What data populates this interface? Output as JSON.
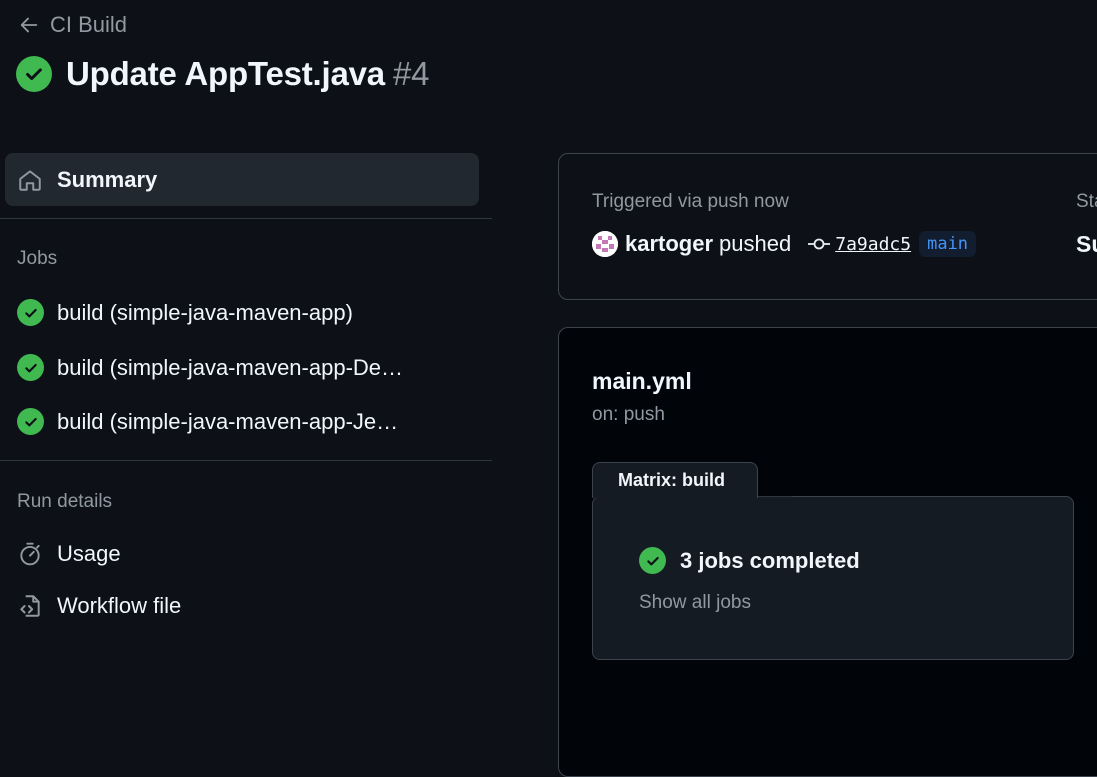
{
  "header": {
    "back_label": "CI Build",
    "title": "Update AppTest.java",
    "run_number": "#4"
  },
  "sidebar": {
    "summary_label": "Summary",
    "jobs_heading": "Jobs",
    "jobs": [
      {
        "label": "build (simple-java-maven-app)",
        "status": "success"
      },
      {
        "label": "build (simple-java-maven-app-De…",
        "status": "success"
      },
      {
        "label": "build (simple-java-maven-app-Je…",
        "status": "success"
      }
    ],
    "run_details_heading": "Run details",
    "usage_label": "Usage",
    "workflow_file_label": "Workflow file"
  },
  "trigger": {
    "text": "Triggered via push now",
    "actor": "kartoger",
    "action": "pushed",
    "commit": "7a9adc5",
    "branch": "main",
    "status_label": "Sta",
    "status_value": "Su"
  },
  "workflow": {
    "name": "main.yml",
    "on": "on: push",
    "matrix_label": "Matrix: build",
    "jobs_completed": "3 jobs completed",
    "show_all": "Show all jobs"
  },
  "colors": {
    "success": "#3fb950",
    "link": "#4493f8",
    "background": "#0d1117"
  },
  "icons": [
    "arrow-left-icon",
    "check-circle-icon",
    "home-icon",
    "stopwatch-icon",
    "file-code-icon",
    "git-commit-icon"
  ]
}
